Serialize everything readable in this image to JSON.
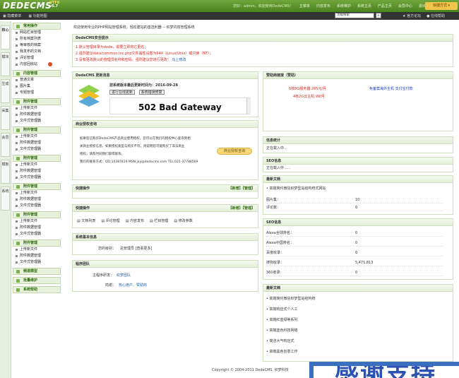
{
  "header": {
    "logo": "DEDECMS",
    "edition": "UTF8",
    "version": "v5.7",
    "user_text": "您好：admin，欢迎使用DedeCMS！",
    "nav": [
      "主菜单",
      "内容发布",
      "系统维护",
      "系统主页",
      "产品主页",
      "会员中心",
      "退出"
    ],
    "skin": "快捷方式 ▾"
  },
  "toolbar": {
    "left": [
      "隐藏菜单",
      "功能地图"
    ],
    "search_placeholder": "功能搜索",
    "right": [
      "官方论坛",
      "在线帮助"
    ]
  },
  "vtabs": [
    "核心",
    "模块",
    "生成",
    "采集",
    "会员",
    "模板",
    "系统"
  ],
  "menu": {
    "groups": [
      {
        "title": "常用操作",
        "items": [
          "网站栏目管理",
          "所有档案列表",
          "等审核的档案",
          "我发布的文档",
          "评论管理",
          "内容回收站"
        ]
      },
      {
        "title": "内容管理",
        "items": [
          "普通文章",
          "图片集",
          "专题管理"
        ]
      },
      {
        "title": "附件管理",
        "items": [
          "上传新文件",
          "附件数据管理",
          "文件式管理器"
        ]
      },
      {
        "title": "附件管理",
        "items": [
          "上传新文件",
          "附件数据管理",
          "文件式管理器"
        ]
      },
      {
        "title": "附件管理",
        "items": [
          "上传新文件",
          "附件数据管理",
          "文件式管理器"
        ]
      },
      {
        "title": "附件管理",
        "items": [
          "上传新文件",
          "附件数据管理",
          "文件式管理器"
        ]
      },
      {
        "title": "附件管理",
        "items": [
          "上传新文件",
          "附件数据管理",
          "文件式管理器"
        ]
      },
      {
        "title": "附件管理",
        "items": [
          "上传新文件",
          "附件数据管理",
          "文件式管理器"
        ]
      }
    ],
    "bottom": [
      "频道模型",
      "批量维护",
      "系统帮助"
    ]
  },
  "welcome": "欢迎使用专业的PHP网站管理系统，轻松建站的首选利器 -- 织梦内容管理系统",
  "security": {
    "title": "DedeCMS安全提示",
    "lines": [
      "1.默认管理目录为dede，需要立即将它更名；",
      "2.强烈建议data/common.inc.php文件属性设置为644（Linux/Unix）或只读（NT）；",
      "3.没有更改默认的管理员名称和密码，强烈建议您进行更改！"
    ],
    "link": "马上修改"
  },
  "update": {
    "title": "DedeCMS 更新消息",
    "info": "您系统版本最后更新时间为：2016-09-28",
    "btn1": "进行在线更新",
    "btn2": "系统错误修复",
    "error": "502 Bad Gateway"
  },
  "license": {
    "title": "商业授权咨询",
    "text": [
      "如果您已购买DedeCMS产品商业使用授权，您可以在我们的授权中心查询到相",
      "关商业授权信息，如果授权类型与购买不符，则说明您可能购买了非法商业",
      "授权，请及时同我们取得联系。",
      "我们的联系方式：QQ:10387819  MSN:jay@dedecms.com  TEL:021-37788569"
    ],
    "btn": "商业授权咨询"
  },
  "quick1": {
    "title": "快捷操作",
    "actions": "【新增】【管理】"
  },
  "quick2": {
    "title": "快捷操作",
    "actions": "【新增】【管理】",
    "items": [
      "文档列表",
      "评论管理",
      "内容发布",
      "栏目管理",
      "修改参数"
    ]
  },
  "sysinfo": {
    "title": "系统基本信息",
    "label": "您的级别：",
    "value": "总管理员 [查看更多]"
  },
  "team": {
    "title": "程序团队",
    "dev_label": "主程序研发：",
    "dev": "织梦团队",
    "thanks_label": "鸣谢：",
    "thanks": "热心用户、赞助商"
  },
  "sponsor": {
    "title": "赞助商链接（赞助）",
    "ads": [
      "6核8G服务器 295元/月",
      "免备案海外主机 支付宝付款",
      "4核2G云主机 99/月"
    ]
  },
  "stats": {
    "title": "信息统计",
    "text": "正在载入中..."
  },
  "seo1": {
    "title": "SEO信息",
    "text": "正在载入中……"
  },
  "news1": {
    "title": "最新文档",
    "items": [
      "高端简约微信织梦型站结构统式网站"
    ],
    "rows": [
      {
        "k": "图片集：",
        "v": "10"
      },
      {
        "k": "评论数：",
        "v": "0"
      }
    ]
  },
  "seo2": {
    "title": "SEO信息",
    "rows": [
      {
        "k": "Alexa全球排名：",
        "v": "0"
      },
      {
        "k": "Alexa中国排名：",
        "v": "0"
      },
      {
        "k": "百度收录：",
        "v": "0"
      },
      {
        "k": "搜狗收录：",
        "v": "5,471,813"
      },
      {
        "k": "360收录：",
        "v": "0"
      }
    ]
  },
  "news2": {
    "title": "最新文档",
    "items": [
      "高端简约微信织梦型站结构统",
      "高端响应式个人工",
      "高端红蓝绿等系列",
      "高端蓝色科技网络",
      "简洁大气响应式",
      "高端黑色创意工作"
    ]
  },
  "footer": "Copyright © 2004-2011 DedeCMS. 织梦科技",
  "overlay": {
    "text": "感谢支持"
  }
}
